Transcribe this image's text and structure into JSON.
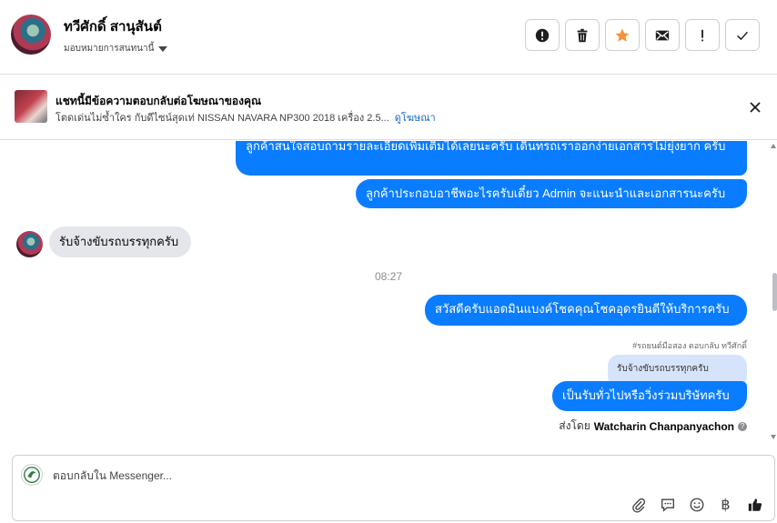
{
  "header": {
    "contact_name": "ทวีศักดิ์ สานุสันต์",
    "assign_label": "มอบหมายการสนทนานี้",
    "toolbar": [
      {
        "name": "spam-button",
        "icon": "alert-circle-icon"
      },
      {
        "name": "delete-button",
        "icon": "trash-icon"
      },
      {
        "name": "star-button",
        "icon": "star-icon"
      },
      {
        "name": "mark-unread-button",
        "icon": "envelope-icon"
      },
      {
        "name": "follow-up-button",
        "icon": "exclamation-icon"
      },
      {
        "name": "mark-done-button",
        "icon": "check-icon"
      }
    ],
    "star_color": "#f7923a"
  },
  "ad_banner": {
    "title": "แชทนี้มีข้อความตอบกลับต่อโฆษณาของคุณ",
    "subtitle": "โตดเด่นไม่ซ้ำใคร กับดีไซน์สุดเท่ NISSAN NAVARA NP300 2018 เครื่อง 2.5...",
    "link": "ดูโฆษณา"
  },
  "messages": {
    "out_1": "ลูกค้าสนใจสอบถามรายละเอียดเพิ่มเติมได้เลยนะครับ เดินทรถเราออกง่ายเอกสารไม่ยุ่งยาก ครับ",
    "out_2": "ลูกค้าประกอบอาชีพอะไรครับเดี๋ยว Admin จะแนะนำและเอกสารนะครับ",
    "in_1": "รับจ้างขับรถบรรทุกครับ",
    "time": "08:27",
    "out_3": "สวัสดีครับแอดมินแบงค์โชคคุณโชคอุดรยินดีให้บริการครับ",
    "reply_meta": "#รถยนต์มือสอง ตอบกลับ ทวีศักดิ์",
    "quoted": "รับจ้างขับรถบรรทุกครับ",
    "out_4": "เป็นรับทั่วไปหรือวิ่งร่วมบริษัทครับ",
    "sent_by_prefix": "ส่งโดย",
    "sent_by_name": "Watcharin Chanpanyachon"
  },
  "composer": {
    "placeholder": "ตอบกลับใน Messenger...",
    "tools": [
      "paperclip-icon",
      "saved-reply-icon",
      "emoji-icon",
      "baht-icon",
      "like-icon"
    ],
    "baht_symbol": "฿"
  },
  "colors": {
    "outgoing_bubble": "#0a7cff",
    "incoming_bubble": "#e4e6eb",
    "link": "#1767c6"
  }
}
